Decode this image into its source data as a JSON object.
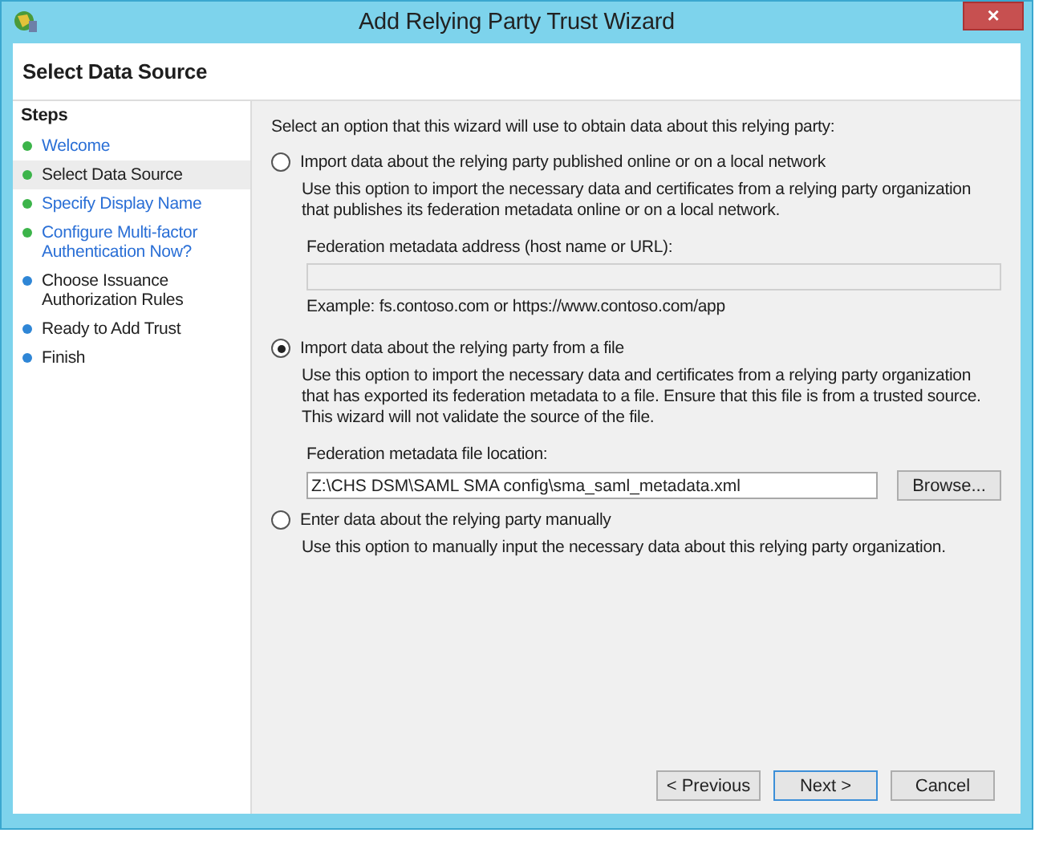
{
  "window": {
    "title": "Add Relying Party Trust Wizard",
    "close": "×"
  },
  "header": {
    "title": "Select Data Source"
  },
  "steps": {
    "heading": "Steps",
    "items": [
      {
        "label": "Welcome",
        "color": "#3cb44a",
        "link": true,
        "selected": false
      },
      {
        "label": "Select Data Source",
        "color": "#3cb44a",
        "link": false,
        "selected": true
      },
      {
        "label": "Specify Display Name",
        "color": "#3cb44a",
        "link": true,
        "selected": false
      },
      {
        "label": "Configure Multi-factor Authentication Now?",
        "color": "#3cb44a",
        "link": true,
        "selected": false
      },
      {
        "label": "Choose Issuance Authorization Rules",
        "color": "#2f86d6",
        "link": false,
        "selected": false
      },
      {
        "label": "Ready to Add Trust",
        "color": "#2f86d6",
        "link": false,
        "selected": false
      },
      {
        "label": "Finish",
        "color": "#2f86d6",
        "link": false,
        "selected": false
      }
    ]
  },
  "intro": "Select an option that this wizard will use to obtain data about this relying party:",
  "options": [
    {
      "label": "Import data about the relying party published online or on a local network",
      "selected": false,
      "description": "Use this option to import the necessary data and certificates from a relying party organization that publishes its federation metadata online or on a local network.",
      "field": {
        "label": "Federation metadata address (host name or URL):",
        "disabled": true,
        "hint": "Example: fs.contoso.com or https://www.contoso.com/app"
      }
    },
    {
      "label": "Import data about the relying party from a file",
      "selected": true,
      "description": "Use this option to import the necessary data and certificates from a relying party organization that has exported its federation metadata to a file. Ensure that this file is from a trusted source.  This wizard will not validate the source of the file.",
      "field": {
        "label": "Federation metadata file location:",
        "disabled": false,
        "value": "Z:\\CHS DSM\\SAML SMA config\\sma_saml_metadata.xml",
        "button": "Browse..."
      }
    },
    {
      "label": "Enter data about the relying party manually",
      "selected": false,
      "description": "Use this option to manually input the necessary data about this relying party organization."
    }
  ],
  "buttons": [
    {
      "label": "< Previous",
      "focused": false
    },
    {
      "label": "Next >",
      "focused": true
    },
    {
      "label": "Cancel",
      "focused": false
    }
  ]
}
